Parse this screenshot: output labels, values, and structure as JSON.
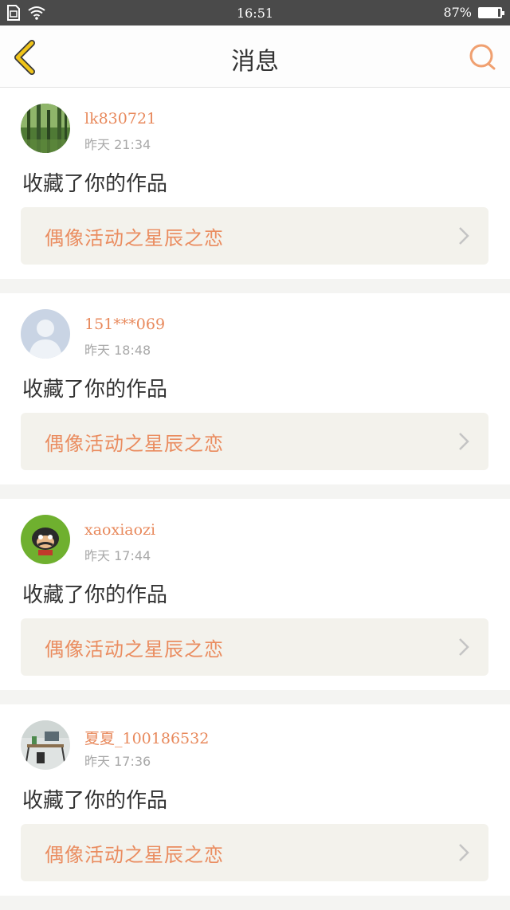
{
  "status_bar": {
    "time": "16:51",
    "battery": "87%",
    "battery_level": 0.87
  },
  "navbar": {
    "title": "消息"
  },
  "messages": [
    {
      "username": "lk830721",
      "time": "昨天 21:34",
      "action": "收藏了你的作品",
      "work_title": "偶像活动之星辰之恋",
      "avatar": "forest-avatar"
    },
    {
      "username": "151***069",
      "time": "昨天 18:48",
      "action": "收藏了你的作品",
      "work_title": "偶像活动之星辰之恋",
      "avatar": "default-avatar"
    },
    {
      "username": "xaoxiaozi",
      "time": "昨天 17:44",
      "action": "收藏了你的作品",
      "work_title": "偶像活动之星辰之恋",
      "avatar": "monkey-avatar"
    },
    {
      "username": "夏夏_100186532",
      "time": "昨天 17:36",
      "action": "收藏了你的作品",
      "work_title": "偶像活动之星辰之恋",
      "avatar": "desk-photo-avatar"
    }
  ],
  "colors": {
    "accent": "#e8895c",
    "back_arrow": "#f0c419",
    "link_bg": "#f3f2ec",
    "status_bar": "#4a4a4a"
  }
}
